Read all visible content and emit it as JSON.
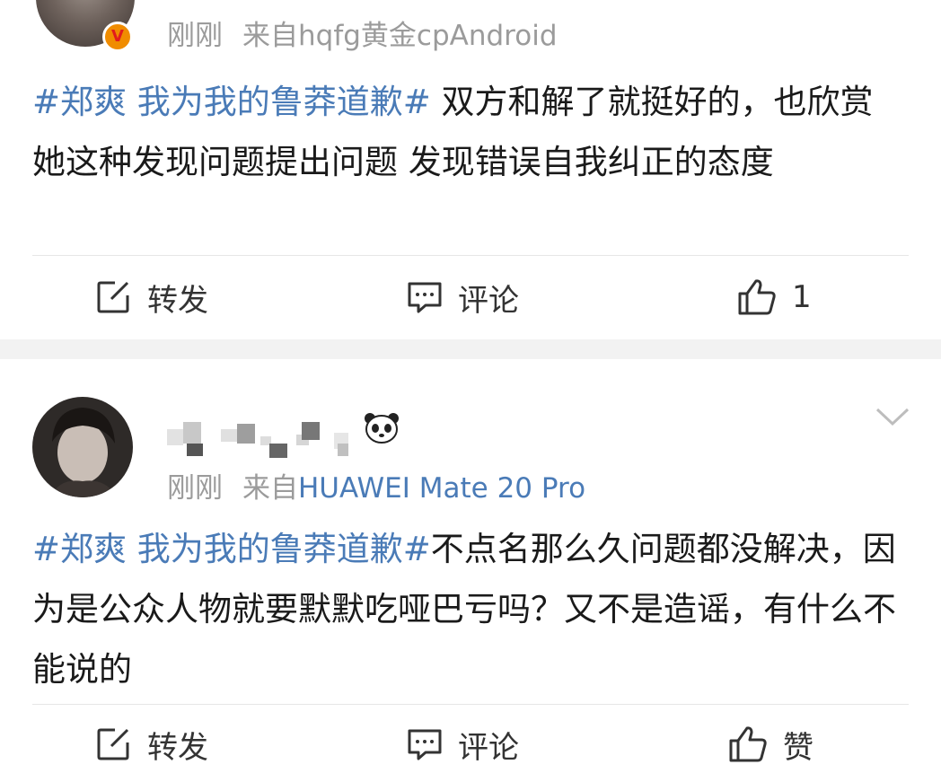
{
  "post1": {
    "meta": {
      "time": "刚刚",
      "source_prefix": "来自",
      "source_name": "hqfg黄金cpAndroid"
    },
    "badge": "V",
    "content": {
      "topic": "#郑爽 我为我的鲁莽道歉#",
      "text": " 双方和解了就挺好的，也欣赏她这种发现问题提出问题 发现错误自我纠正的态度"
    },
    "actions": {
      "repost": "转发",
      "comment": "评论",
      "like": "1"
    }
  },
  "post2": {
    "meta": {
      "time": "刚刚",
      "source_prefix": "来自",
      "source_name": "HUAWEI Mate 20 Pro"
    },
    "content": {
      "topic": "#郑爽 我为我的鲁莽道歉#",
      "text": "不点名那么久问题都没解决，因为是公众人物就要默默吃哑巴亏吗？又不是造谣，有什么不能说的"
    },
    "actions": {
      "repost": "转发",
      "comment": "评论",
      "like": "赞"
    }
  },
  "icons": {
    "repost": "edit-square-icon",
    "comment": "comment-bubble-icon",
    "like": "thumbs-up-icon",
    "menu": "chevron-down-icon",
    "panda": "panda-icon"
  },
  "colors": {
    "topic": "#4a7bb7",
    "meta": "#9b9b9b",
    "separator": "#f2f2f2"
  }
}
